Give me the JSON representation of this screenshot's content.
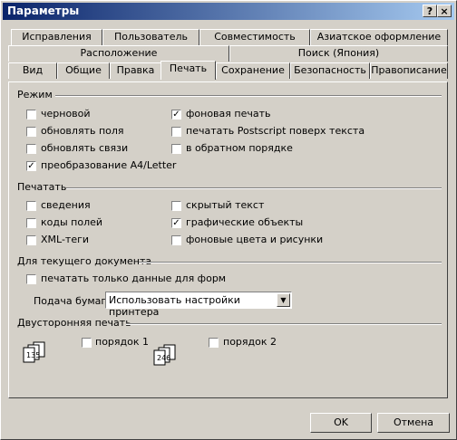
{
  "window": {
    "title": "Параметры",
    "help_label": "?",
    "close_label": "×"
  },
  "tabs": {
    "row1": [
      "Исправления",
      "Пользователь",
      "Совместимость",
      "Азиатское оформление"
    ],
    "row2": [
      "Расположение",
      "Поиск (Япония)"
    ],
    "row3": [
      "Вид",
      "Общие",
      "Правка",
      "Печать",
      "Сохранение",
      "Безопасность",
      "Правописание"
    ]
  },
  "mode": {
    "title": "Режим",
    "items": [
      {
        "label": "черновой",
        "checked": false
      },
      {
        "label": "обновлять поля",
        "checked": false
      },
      {
        "label": "обновлять связи",
        "checked": false
      },
      {
        "label": "преобразование A4/Letter",
        "checked": true
      },
      {
        "label": "фоновая печать",
        "checked": true
      },
      {
        "label": "печатать Postscript поверх текста",
        "checked": false
      },
      {
        "label": "в обратном порядке",
        "checked": false
      }
    ]
  },
  "print": {
    "title": "Печатать",
    "items": [
      {
        "label": "сведения",
        "checked": false
      },
      {
        "label": "коды полей",
        "checked": false
      },
      {
        "label": "XML-теги",
        "checked": false
      },
      {
        "label": "скрытый текст",
        "checked": false
      },
      {
        "label": "графические объекты",
        "checked": true
      },
      {
        "label": "фоновые цвета и рисунки",
        "checked": false
      }
    ]
  },
  "document": {
    "title": "Для текущего документа",
    "forms_only": {
      "label": "печатать только данные для форм",
      "checked": false
    },
    "paper_label": "Подача бумаги:",
    "paper_value": "Использовать настройки принтера"
  },
  "duplex": {
    "title": "Двусторонняя печать",
    "order1": {
      "label": "порядок 1",
      "checked": false,
      "icon_text": "135"
    },
    "order2": {
      "label": "порядок 2",
      "checked": false,
      "icon_text": "246"
    }
  },
  "buttons": {
    "ok": "OK",
    "cancel": "Отмена"
  }
}
